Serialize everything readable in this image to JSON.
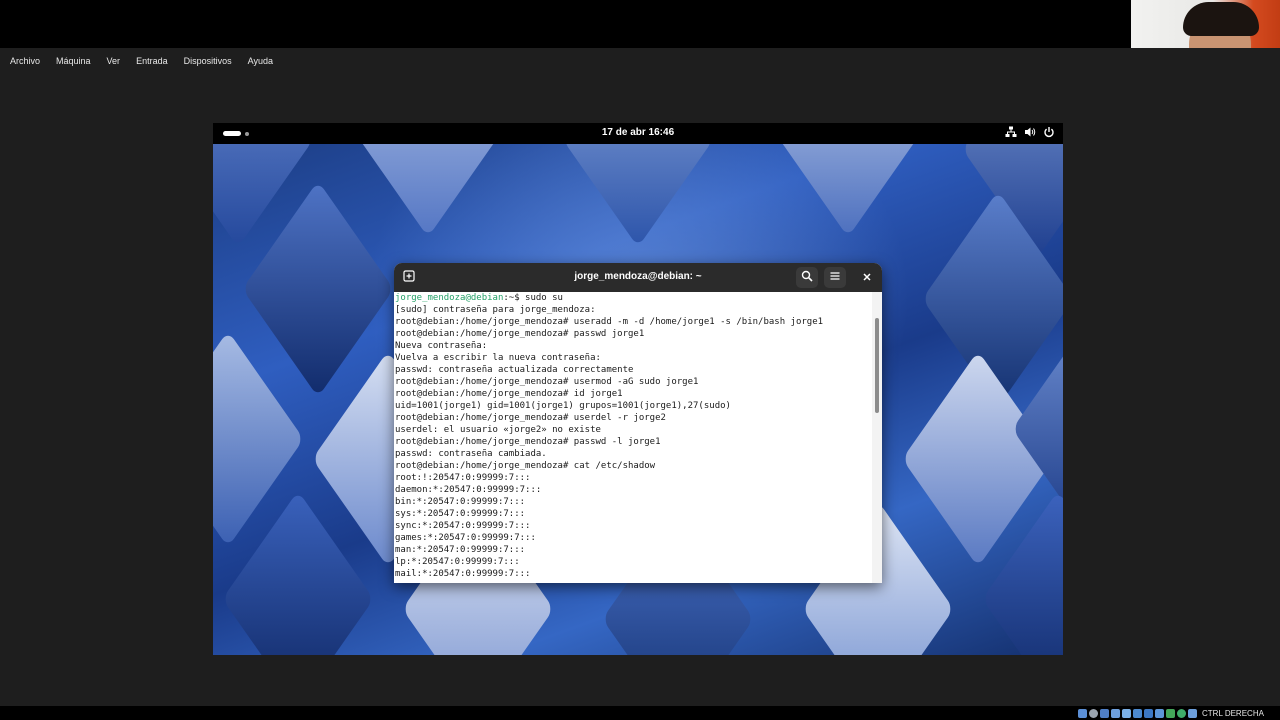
{
  "host_menu": [
    "Archivo",
    "Máquina",
    "Ver",
    "Entrada",
    "Dispositivos",
    "Ayuda"
  ],
  "gnome_panel": {
    "clock": "17 de abr  16:46"
  },
  "terminal": {
    "title": "jorge_mendoza@debian: ~",
    "first_line": {
      "user_host": "jorge_mendoza@debian",
      "rest": ":~$ sudo su"
    },
    "lines": [
      "[sudo] contraseña para jorge_mendoza:",
      "root@debian:/home/jorge_mendoza# useradd -m -d /home/jorge1 -s /bin/bash jorge1",
      "root@debian:/home/jorge_mendoza# passwd jorge1",
      "Nueva contraseña:",
      "Vuelva a escribir la nueva contraseña:",
      "passwd: contraseña actualizada correctamente",
      "root@debian:/home/jorge_mendoza# usermod -aG sudo jorge1",
      "root@debian:/home/jorge_mendoza# id jorge1",
      "uid=1001(jorge1) gid=1001(jorge1) grupos=1001(jorge1),27(sudo)",
      "root@debian:/home/jorge_mendoza# userdel -r jorge2",
      "userdel: el usuario «jorge2» no existe",
      "root@debian:/home/jorge_mendoza# passwd -l jorge1",
      "passwd: contraseña cambiada.",
      "root@debian:/home/jorge_mendoza# cat /etc/shadow",
      "root:!:20547:0:99999:7:::",
      "daemon:*:20547:0:99999:7:::",
      "bin:*:20547:0:99999:7:::",
      "sys:*:20547:0:99999:7:::",
      "sync:*:20547:0:99999:7:::",
      "games:*:20547:0:99999:7:::",
      "man:*:20547:0:99999:7:::",
      "lp:*:20547:0:99999:7:::",
      "mail:*:20547:0:99999:7:::"
    ]
  },
  "host_statusbar": {
    "host_key": "CTRL DERECHA"
  },
  "colors": {
    "prompt_user": "#26a269",
    "terminal_header": "#2b2b2b",
    "wallpaper_blue": "#2f5ec0"
  }
}
